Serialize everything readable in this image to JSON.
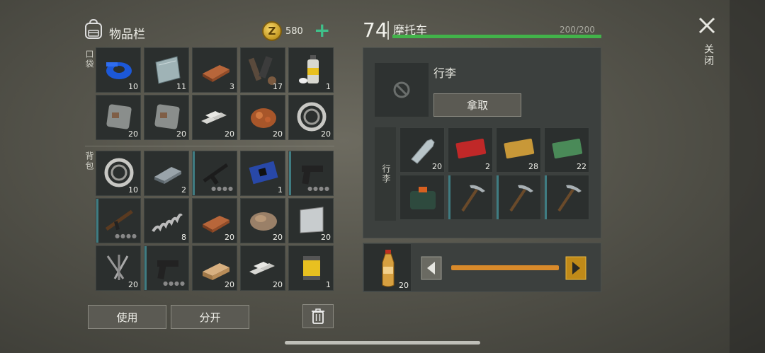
{
  "inventory": {
    "title": "物品栏",
    "coins": "580",
    "coin_symbol": "Z",
    "add_symbol": "+",
    "pocket_label": "口袋",
    "backpack_label": "背包",
    "pocket_items": [
      {
        "icon": "tape-icon",
        "count": "10"
      },
      {
        "icon": "metal-plate-icon",
        "count": "11"
      },
      {
        "icon": "copper-bar-icon",
        "count": "3"
      },
      {
        "icon": "machine-parts-icon",
        "count": "17"
      },
      {
        "icon": "spray-can-icon",
        "count": "1"
      },
      {
        "icon": "rusty-plate-icon",
        "count": "20"
      },
      {
        "icon": "rusty-plate-icon",
        "count": "20"
      },
      {
        "icon": "aluminum-bars-icon",
        "count": "20"
      },
      {
        "icon": "copper-ore-icon",
        "count": "20"
      },
      {
        "icon": "bearing-icon",
        "count": "20"
      }
    ],
    "backpack_items": [
      {
        "icon": "bearing-icon",
        "count": "10"
      },
      {
        "icon": "steel-bar-icon",
        "count": "2"
      },
      {
        "icon": "rifle-icon",
        "count": ""
      },
      {
        "icon": "circuit-board-icon",
        "count": "1"
      },
      {
        "icon": "pistol-icon",
        "count": ""
      },
      {
        "icon": "ak-rifle-icon",
        "count": ""
      },
      {
        "icon": "spring-icon",
        "count": "8"
      },
      {
        "icon": "copper-bar-icon",
        "count": "20"
      },
      {
        "icon": "rock-ore-icon",
        "count": "20"
      },
      {
        "icon": "steel-sheet-icon",
        "count": "20"
      },
      {
        "icon": "nails-icon",
        "count": "20"
      },
      {
        "icon": "pistol-icon",
        "count": ""
      },
      {
        "icon": "wood-plank-icon",
        "count": "20"
      },
      {
        "icon": "aluminum-bars-icon",
        "count": "20"
      },
      {
        "icon": "oil-filter-icon",
        "count": "1"
      }
    ],
    "use_label": "使用",
    "split_label": "分开"
  },
  "vehicle": {
    "number": "74",
    "name": "摩托车",
    "capacity": "200/200",
    "capacity_fraction": 1.0,
    "luggage_title": "行李",
    "take_label": "拿取",
    "section_label": "行李",
    "items": [
      {
        "icon": "water-bottle-icon",
        "count": "20"
      },
      {
        "icon": "red-coupon-icon",
        "count": "2"
      },
      {
        "icon": "yellow-coupon-icon",
        "count": "28"
      },
      {
        "icon": "green-coupon-icon",
        "count": "22"
      },
      {
        "icon": "medkit-bag-icon",
        "count": ""
      },
      {
        "icon": "pickaxe-icon",
        "count": ""
      },
      {
        "icon": "pickaxe-icon",
        "count": ""
      },
      {
        "icon": "pickaxe-icon",
        "count": ""
      }
    ],
    "transfer_item_count": "20"
  },
  "close_label": "关闭",
  "colors": {
    "accent_green": "#42b34a",
    "coin_gold": "#d9ab2c",
    "slider_orange": "#d98a2a",
    "stripe_teal": "#3f7c82"
  }
}
